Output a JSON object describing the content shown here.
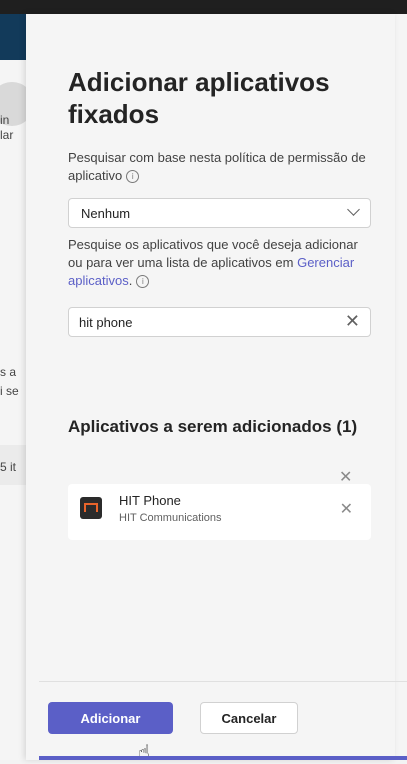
{
  "background": {
    "snippets": [
      "in",
      "lar",
      "s a",
      "i se",
      "5 it"
    ]
  },
  "panel": {
    "title": "Adicionar aplicativos fixados",
    "policy_label": "Pesquisar com base nesta política de permissão de aplicativo",
    "policy_select_value": "Nenhum",
    "search_help_text": "Pesquise os aplicativos que você deseja adicionar ou para ver uma lista de aplicativos em",
    "search_help_link": "Gerenciar aplicativos",
    "search_help_suffix": ".",
    "search_value": "hit phone",
    "section_title": "Aplicativos a serem adicionados (1)",
    "apps": [
      {
        "name": "HIT Phone",
        "company": "HIT Communications"
      }
    ],
    "buttons": {
      "add": "Adicionar",
      "cancel": "Cancelar"
    }
  },
  "colors": {
    "accent": "#5b5fc7",
    "app_logo": "#e8642b"
  }
}
